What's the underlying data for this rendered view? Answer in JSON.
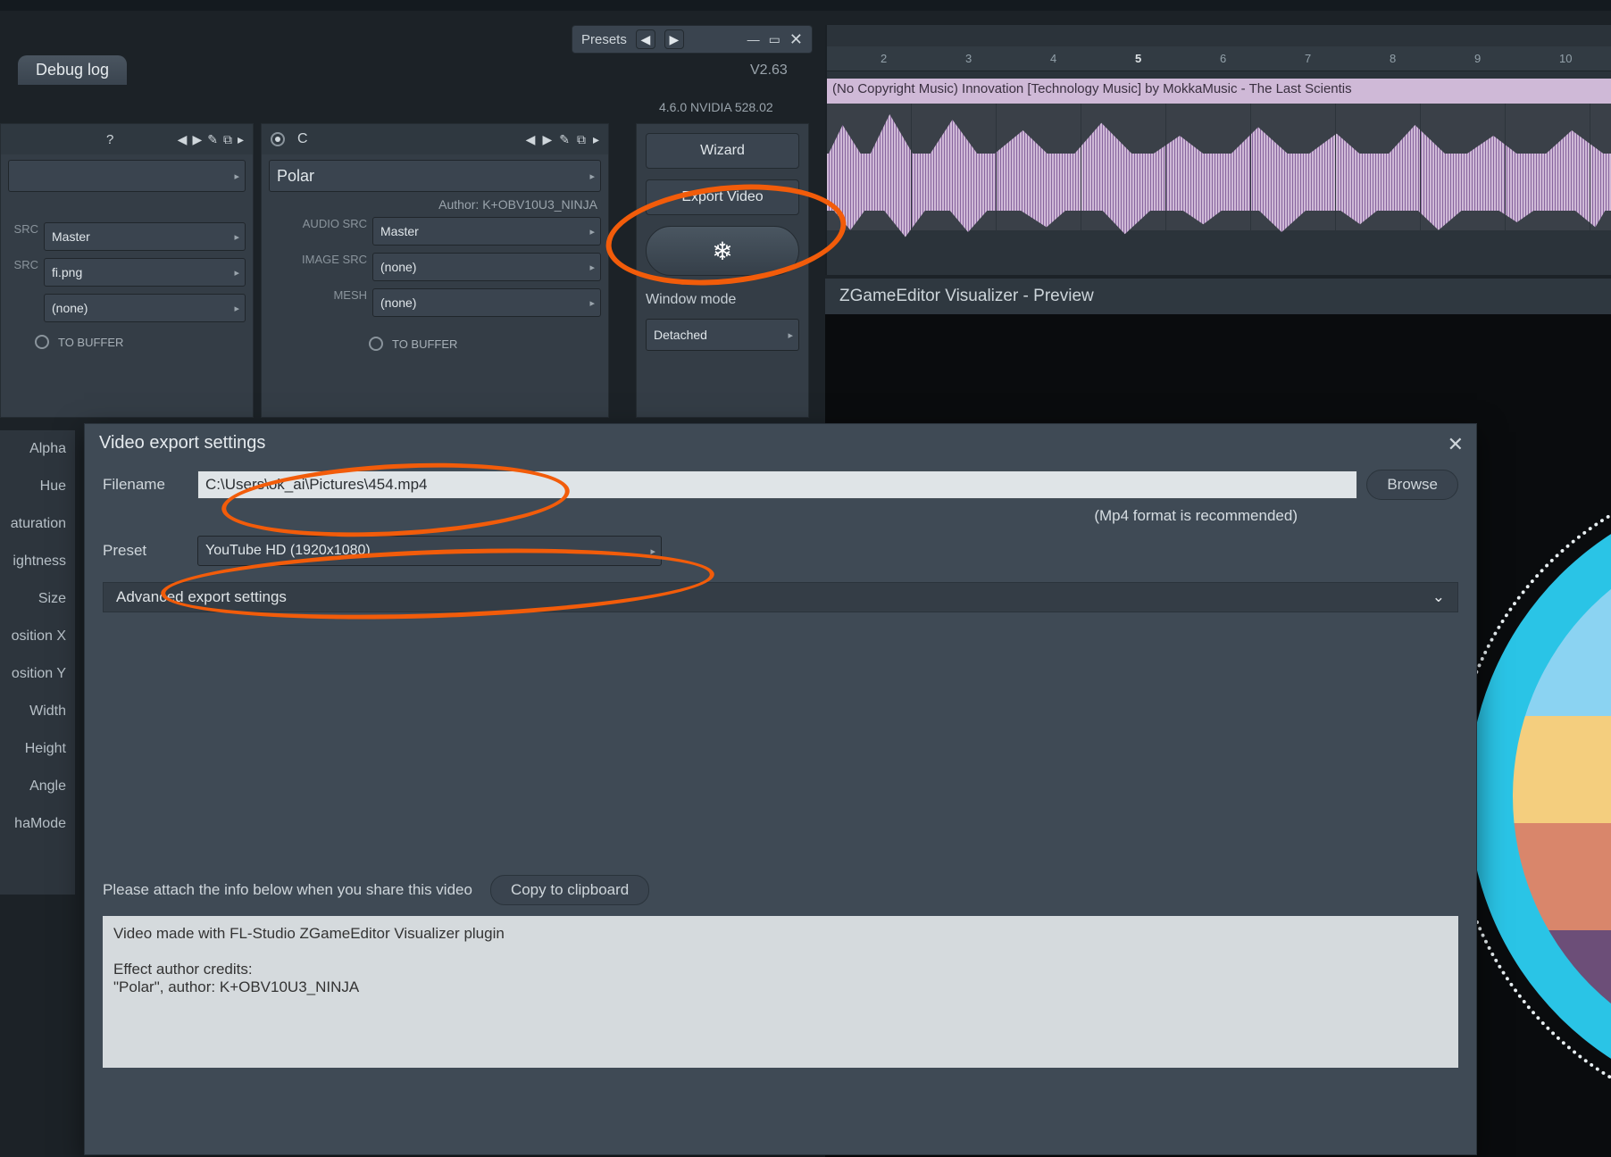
{
  "top": {
    "tab_label": "Debug log",
    "presets_label": "Presets",
    "version": "V2.63",
    "driver": "4.6.0 NVIDIA 528.02"
  },
  "left_panel": {
    "src_label": "SRC",
    "src1_value": "Master",
    "src2_value": "fi.png",
    "src3_value": "(none)",
    "tobuffer_label": "TO BUFFER"
  },
  "mid_panel": {
    "header_letter": "C",
    "title": "Polar",
    "author_prefix": "Author:",
    "author": "K+OBV10U3_NINJA",
    "audio_src_label": "AUDIO SRC",
    "audio_src_value": "Master",
    "image_src_label": "IMAGE SRC",
    "image_src_value": "(none)",
    "mesh_label": "MESH",
    "mesh_value": "(none)",
    "tobuffer_label": "TO BUFFER"
  },
  "right_panel": {
    "wizard": "Wizard",
    "export_video": "Export Video",
    "window_mode_label": "Window mode",
    "window_mode_value": "Detached"
  },
  "timeline": {
    "ticks": [
      "2",
      "3",
      "4",
      "5",
      "6",
      "7",
      "8",
      "9",
      "10"
    ],
    "clip_title": "(No Copyright Music) Innovation [Technology Music] by MokkaMusic - The Last Scientis"
  },
  "preview": {
    "title": "ZGameEditor Visualizer - Preview"
  },
  "sidebar_params": [
    "Alpha",
    "Hue",
    "aturation",
    "ightness",
    "Size",
    "osition X",
    "osition Y",
    "Width",
    "Height",
    "Angle",
    "haMode"
  ],
  "dialog": {
    "title": "Video export settings",
    "filename_label": "Filename",
    "filename_value": "C:\\Users\\ok_ai\\Pictures\\454.mp4",
    "browse_label": "Browse",
    "hint": "(Mp4 format is recommended)",
    "preset_label": "Preset",
    "preset_value": "YouTube HD (1920x1080)",
    "advanced_label": "Advanced export settings",
    "attach_label": "Please attach the info below when you share this video",
    "copy_label": "Copy to clipboard",
    "info_text": "Video made with FL-Studio ZGameEditor Visualizer plugin\n\nEffect author credits:\n\"Polar\", author: K+OBV10U3_NINJA"
  },
  "colors": {
    "annotation": "#f25c0a",
    "clip": "#cfb9d7",
    "accent": "#2ac4e6"
  }
}
